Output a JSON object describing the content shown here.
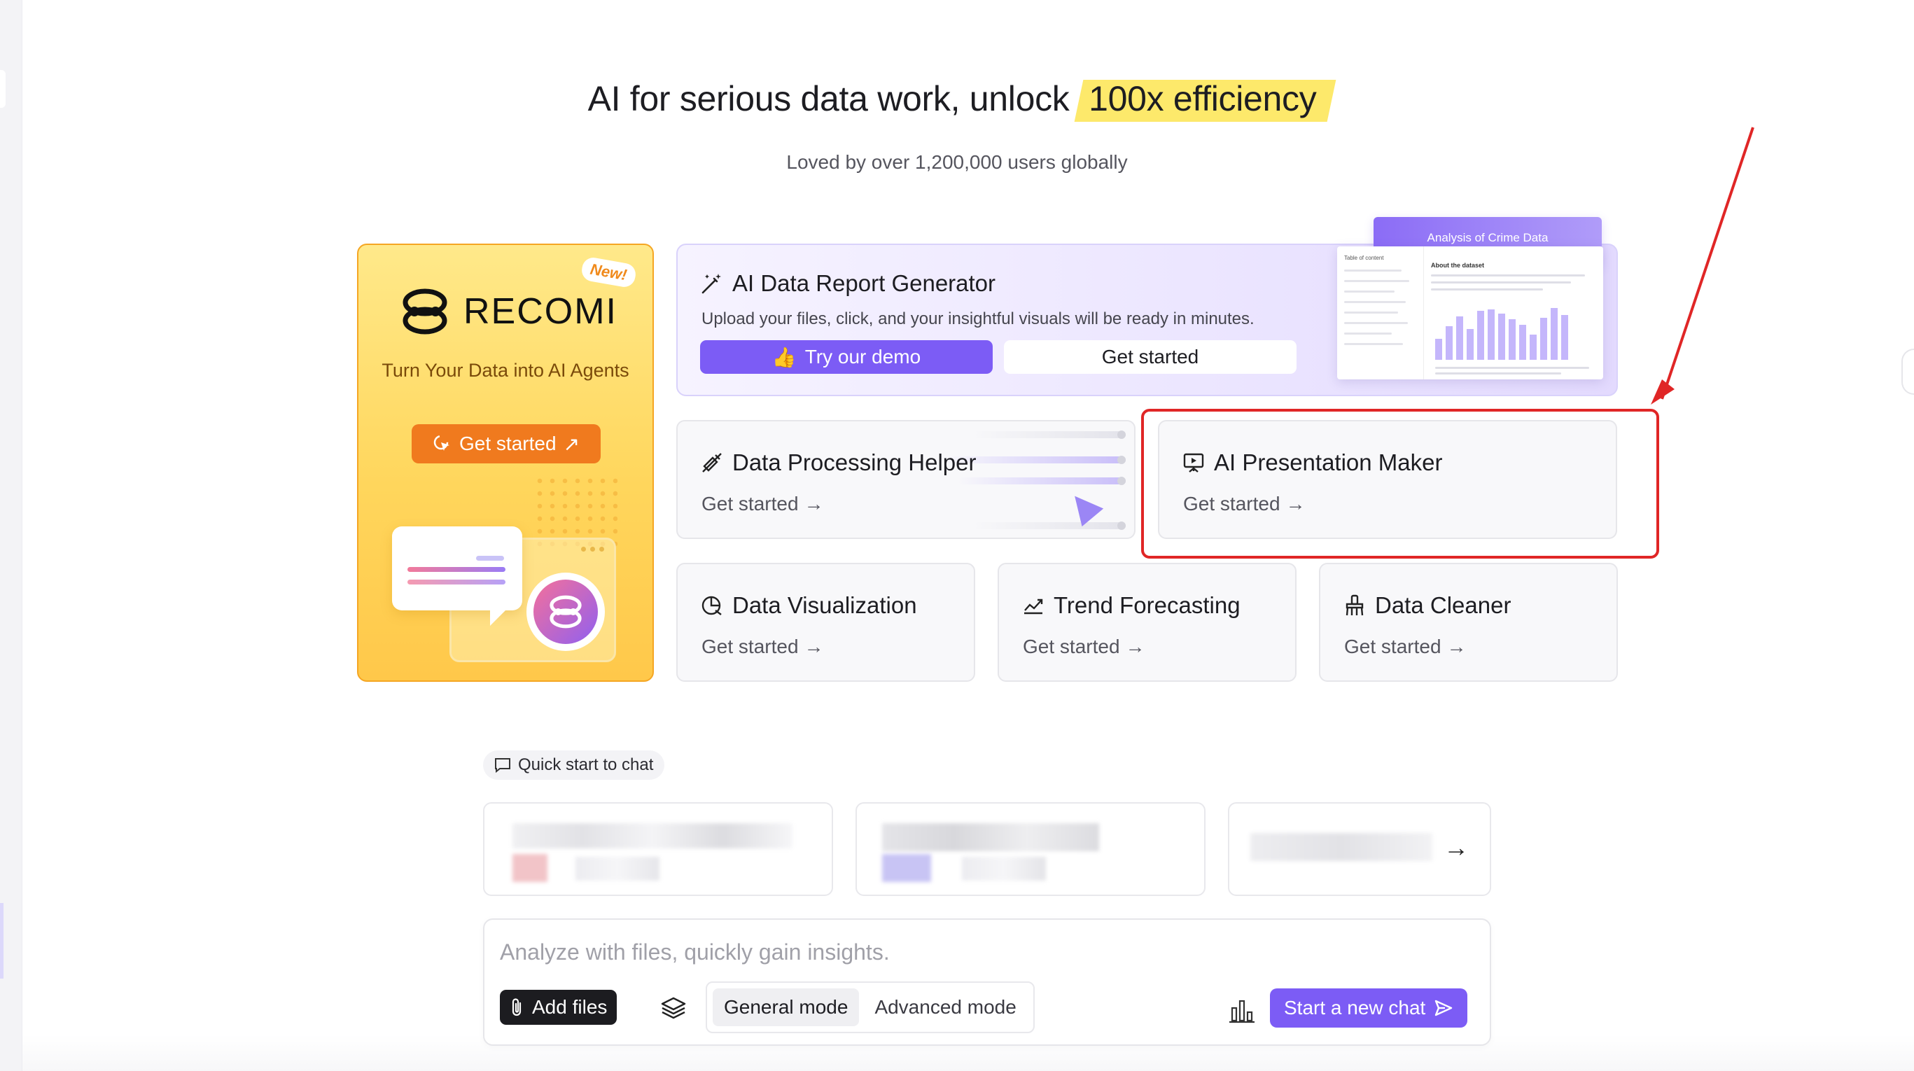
{
  "hero": {
    "headline_prefix": "AI for serious data work, unlock",
    "headline_highlight": "100x efficiency",
    "subline": "Loved by over 1,200,000 users globally"
  },
  "recomi": {
    "badge": "New!",
    "brand": "RECOMI",
    "tagline": "Turn Your Data into AI Agents",
    "cta": "Get started"
  },
  "report_generator": {
    "title": "AI Data Report Generator",
    "description": "Upload your files, click, and your insightful visuals will be ready in minutes.",
    "demo_label": "Try our demo",
    "get_started_label": "Get started",
    "preview_title": "Analysis of Crime Data",
    "preview_toc": "Table of content",
    "preview_about": "About the dataset"
  },
  "tools": [
    {
      "title": "Data Processing Helper",
      "link": "Get started",
      "icon": "data-processing-icon"
    },
    {
      "title": "AI Presentation Maker",
      "link": "Get started",
      "icon": "presentation-icon"
    },
    {
      "title": "Data Visualization",
      "link": "Get started",
      "icon": "data-visualization-icon"
    },
    {
      "title": "Trend Forecasting",
      "link": "Get started",
      "icon": "trend-icon"
    },
    {
      "title": "Data Cleaner",
      "link": "Get started",
      "icon": "cleaner-icon"
    }
  ],
  "quick_start": {
    "label": "Quick start to chat"
  },
  "composer": {
    "placeholder": "Analyze with files, quickly gain insights.",
    "add_files": "Add files",
    "modes": [
      "General mode",
      "Advanced mode"
    ],
    "active_mode": "General mode",
    "submit": "Start a new chat"
  },
  "colors": {
    "accent": "#7c5cf5",
    "highlight": "#fde96b",
    "annotation": "#e02626",
    "recomi_orange": "#f07a1e"
  }
}
